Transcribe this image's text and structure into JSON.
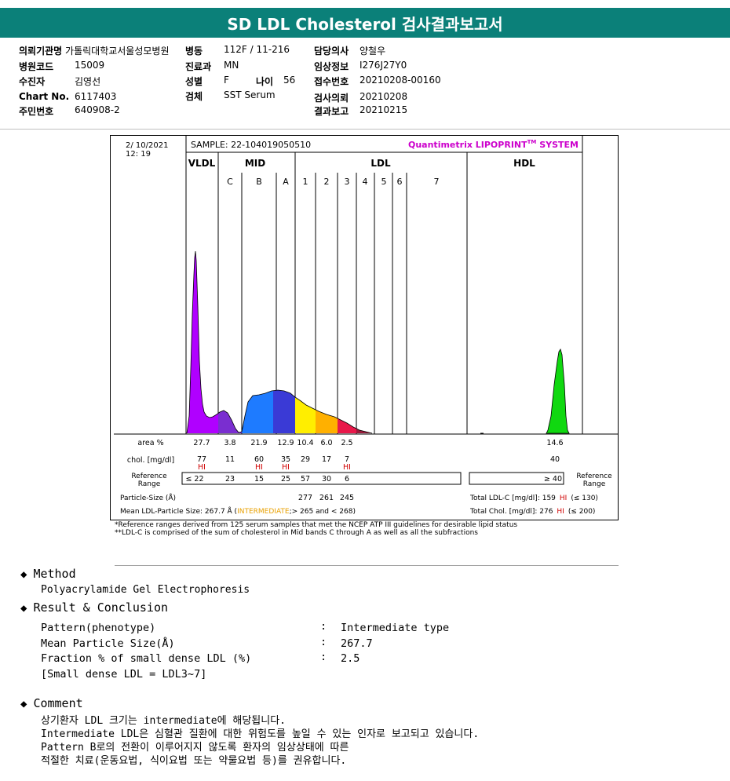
{
  "title": "SD LDL Cholesterol 검사결과보고서",
  "info": {
    "col1": [
      {
        "k": "의뢰기관명",
        "v": "가톨릭대학교서울성모병원"
      },
      {
        "k": "병원코드",
        "v": "15009"
      },
      {
        "k": "수진자",
        "v": "김영선"
      },
      {
        "k": "Chart No.",
        "v": "6117403"
      },
      {
        "k": "주민번호",
        "v": "640908-2"
      }
    ],
    "col2": [
      {
        "k": "병동",
        "v": "112F / 11-216"
      },
      {
        "k": "진료과",
        "v": "MN"
      },
      {
        "k": "성별",
        "v": "F"
      },
      {
        "k": "검체",
        "v": "SST Serum"
      }
    ],
    "age": {
      "k": "나이",
      "v": "56"
    },
    "col3": [
      {
        "k": "담당의사",
        "v": "양철우"
      },
      {
        "k": "임상정보",
        "v": "I276J27Y0"
      },
      {
        "k": "접수번호",
        "v": "20210208-00160"
      },
      {
        "k": "검사의뢰",
        "v": "20210208"
      },
      {
        "k": "결과보고",
        "v": "20210215"
      }
    ]
  },
  "chart_data": {
    "type": "area",
    "date": "2/ 10/2021",
    "time": "12: 19",
    "sample": "SAMPLE:   22-104019050510",
    "system": "Quantimetrix LIPOPRINT",
    "system_tm": "TM",
    "system_suffix": " SYSTEM",
    "groups": [
      "VLDL",
      "MID",
      "LDL",
      "HDL"
    ],
    "bands": [
      "C",
      "B",
      "A",
      "1",
      "2",
      "3",
      "4",
      "5",
      "6",
      "7"
    ],
    "area_label": "area %",
    "area": [
      "27.7",
      "3.8",
      "21.9",
      "12.9",
      "10.4",
      "6.0",
      "2.5",
      "",
      "",
      "",
      "14.6"
    ],
    "chol_label": "chol. [mg/dl]",
    "chol": [
      "77",
      "11",
      "60",
      "35",
      "29",
      "17",
      "7",
      "",
      "",
      "",
      "40"
    ],
    "hi_flags": [
      "HI",
      "",
      "HI",
      "HI",
      "",
      "",
      "HI"
    ],
    "ref_label_1": "Reference",
    "ref_label_2": "Range",
    "ref_left": [
      "≤ 22",
      "23",
      "15",
      "25",
      "57",
      "30",
      "6"
    ],
    "ref_hdl": "≥ 40",
    "particle_size_label": "Particle-Size (Å)",
    "particle_sizes": [
      "277",
      "261",
      "245"
    ],
    "mean_label": "Mean LDL-Particle Size:   267.7 Å  (",
    "mean_type": "INTERMEDIATE",
    "mean_suffix": ";> 265 and  < 268)",
    "total_ldl_label": "Total LDL-C [mg/dl]:  159",
    "total_ldl_flag": "HI",
    "total_ldl_ref": "(≤ 130)",
    "total_chol_label": "Total Chol. [mg/dl]:  276",
    "total_chol_flag": "HI",
    "total_chol_ref": "(≤ 200)"
  },
  "footnotes": [
    "*Reference ranges derived from 125 serum samples that met the NCEP ATP III guidelines for desirable lipid status",
    "**LDL-C is comprised of the sum of cholesterol in Mid bands C through A as well as all the subfractions"
  ],
  "method": {
    "heading": "Method",
    "text": "Polyacrylamide Gel Electrophoresis"
  },
  "result": {
    "heading": "Result & Conclusion",
    "rows": [
      {
        "label": "Pattern(phenotype)",
        "value": "Intermediate type"
      },
      {
        "label": "Mean Particle Size(Å)",
        "value": "267.7"
      },
      {
        "label": "Fraction % of small dense LDL (%)",
        "value": "2.5"
      }
    ],
    "note": "[Small dense LDL = LDL3~7]"
  },
  "comment": {
    "heading": "Comment",
    "lines": [
      "상기환자 LDL 크기는 intermediate에 해당됩니다.",
      "Intermediate LDL은 심혈관 질환에 대한 위험도를 높일 수 있는 인자로 보고되고 있습니다.",
      "Pattern B로의 전환이 이루어지지 않도록 환자의 임상상태에 따른",
      "적절한 치료(운동요법, 식이요법 또는 약물요법 등)를 권유합니다."
    ]
  },
  "colon": ":"
}
